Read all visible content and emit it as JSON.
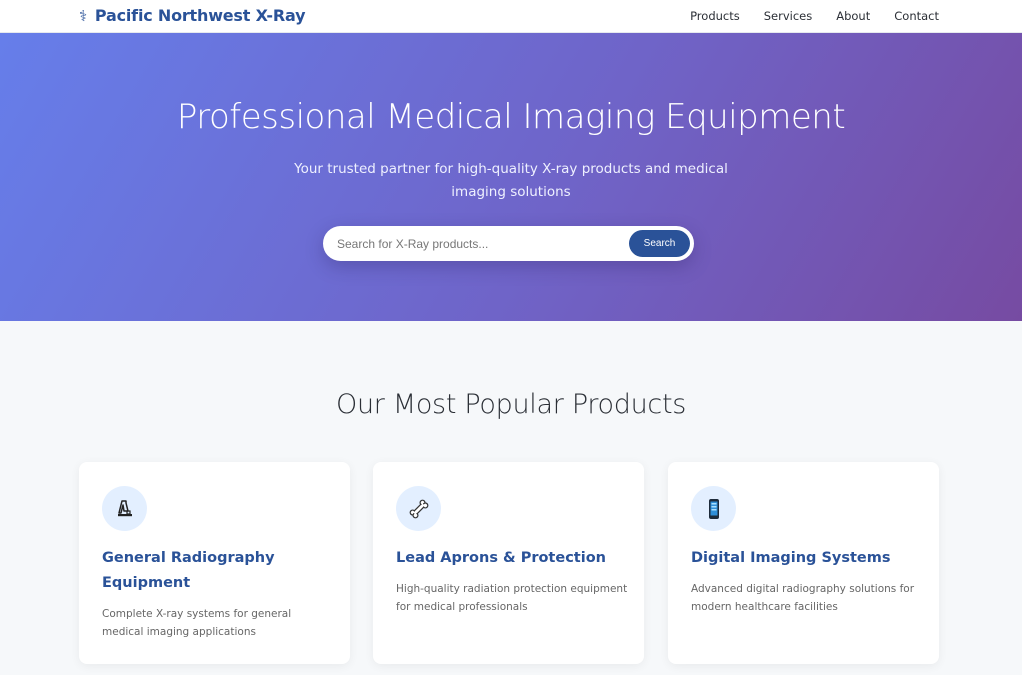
{
  "header": {
    "brand": "Pacific Northwest X-Ray",
    "nav": [
      "Products",
      "Services",
      "About",
      "Contact"
    ]
  },
  "hero": {
    "title": "Professional Medical Imaging Equipment",
    "subtitle": "Your trusted partner for high-quality X-ray products and medical imaging solutions",
    "search_placeholder": "Search for X-Ray products...",
    "search_button": "Search"
  },
  "products": {
    "heading": "Our Most Popular Products",
    "cards": [
      {
        "icon": "x-ray-machine-icon",
        "title": "General Radiography Equipment",
        "description": "Complete X-ray systems for general medical imaging applications"
      },
      {
        "icon": "bone-icon",
        "title": "Lead Aprons & Protection",
        "description": "High-quality radiation protection equipment for medical professionals"
      },
      {
        "icon": "digital-device-icon",
        "title": "Digital Imaging Systems",
        "description": "Advanced digital radiography solutions for modern healthcare facilities"
      }
    ]
  },
  "colors": {
    "brand": "#2a5298",
    "hero_gradient_start": "#667eea",
    "hero_gradient_end": "#764ba2",
    "icon_circle": "#e3efff"
  }
}
